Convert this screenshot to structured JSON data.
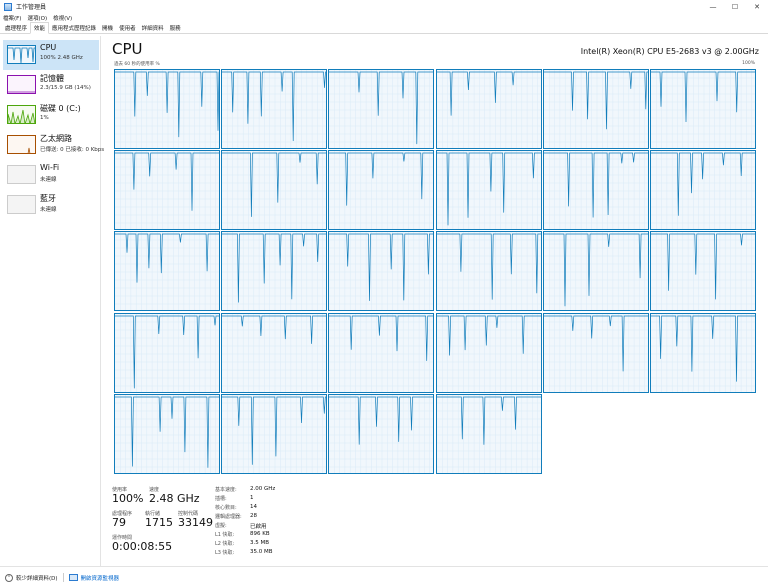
{
  "window": {
    "title": "工作管理員",
    "controls": {
      "minimize": "—",
      "maximize": "☐",
      "close": "✕"
    }
  },
  "menu": [
    "檔案(F)",
    "選項(O)",
    "檢視(V)"
  ],
  "tabs": [
    "處理程序",
    "效能",
    "應用程式歷程記錄",
    "開機",
    "使用者",
    "詳細資料",
    "服務"
  ],
  "active_tab_index": 1,
  "sidebar": {
    "items": [
      {
        "name": "CPU",
        "sub": "100% 2.48 GHz",
        "selected": true,
        "color": "#117dbb"
      },
      {
        "name": "記憶體",
        "sub": "2.3/15.9 GB (14%)",
        "selected": false,
        "color": "#8b12ae"
      },
      {
        "name": "磁碟 0 (C:)",
        "sub": "1%",
        "selected": false,
        "color": "#4da60c"
      },
      {
        "name": "乙太網路",
        "sub": "已傳送: 0 已接收: 0 Kbps",
        "selected": false,
        "color": "#a74f01"
      },
      {
        "name": "Wi-Fi",
        "sub": "未連線",
        "selected": false,
        "color": "#a74f01"
      },
      {
        "name": "藍牙",
        "sub": "未連線",
        "selected": false,
        "color": "#a74f01"
      }
    ]
  },
  "main": {
    "title": "CPU",
    "processor": "Intel(R) Xeon(R) CPU E5-2683 v3 @ 2.00GHz",
    "util_label": "過去 60 秒的使用率 %",
    "max_label": "100%",
    "core_count": 28,
    "accent": "#117dbb"
  },
  "stats": {
    "util_label": "使用率",
    "util_value": "100%",
    "speed_label": "速度",
    "speed_value": "2.48 GHz",
    "proc_label": "處理程序",
    "proc_value": "79",
    "threads_label": "執行緒",
    "threads_value": "1715",
    "handles_label": "控制代碼",
    "handles_value": "33149",
    "uptime_label": "運作時間",
    "uptime_value": "0:00:08:55",
    "details": [
      {
        "k": "基本速度:",
        "v": "2.00 GHz"
      },
      {
        "k": "插槽:",
        "v": "1"
      },
      {
        "k": "核心數目:",
        "v": "14"
      },
      {
        "k": "邏輯處理器:",
        "v": "28"
      },
      {
        "k": "虛擬:",
        "v": "已啟用"
      },
      {
        "k": "L1 快取:",
        "v": "896 KB"
      },
      {
        "k": "L2 快取:",
        "v": "3.5 MB"
      },
      {
        "k": "L3 快取:",
        "v": "35.0 MB"
      }
    ]
  },
  "footer": {
    "fewer_details": "較少詳細資料(D)",
    "open_monitor": "開啟資源監視器"
  }
}
